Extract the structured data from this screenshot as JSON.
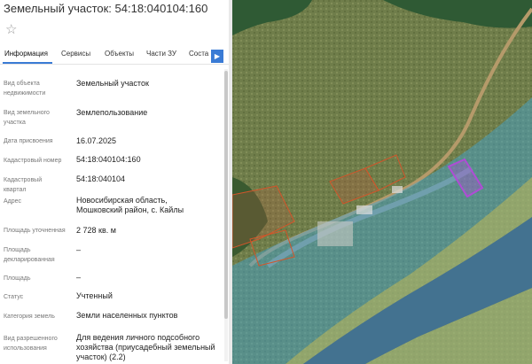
{
  "header": {
    "title": "Земельный участок: 54:18:040104:160"
  },
  "favorite_icon": "star-icon",
  "tabs": [
    "Информация",
    "Сервисы",
    "Объекты",
    "Части ЗУ",
    "Соста"
  ],
  "fields": {
    "object_type_label": "Вид объекта недвижимости",
    "object_type_value": "Земельный участок",
    "land_type_label": "Вид земельного участка",
    "land_type_value": "Землепользование",
    "date_label": "Дата присвоения",
    "date_value": "16.07.2025",
    "cad_number_label": "Кадастровый номер",
    "cad_number_value": "54:18:040104:160",
    "cad_quarter_label": "Кадастровый квартал",
    "cad_quarter_value": "54:18:040104",
    "address_label": "Адрес",
    "address_value": "Новосибирская область, Мошковский район, с. Кайлы",
    "area_spec_label": "Площадь уточненная",
    "area_spec_value": "2 728 кв. м",
    "area_decl_label": "Площадь декларированная",
    "area_decl_value": "–",
    "area_label": "Площадь",
    "area_value": "–",
    "status_label": "Статус",
    "status_value": "Учтенный",
    "category_label": "Категория земель",
    "category_value": "Земли населенных пунктов",
    "permitted_use_label": "Вид разрешенного использования",
    "permitted_use_value": "Для ведения личного подсобного хозяйства (приусадебный земельный участок) (2.2)"
  },
  "colors": {
    "accent": "#3a7bd5",
    "selected_parcel": "#b04cd6",
    "parcel_outline": "#d2552a"
  }
}
